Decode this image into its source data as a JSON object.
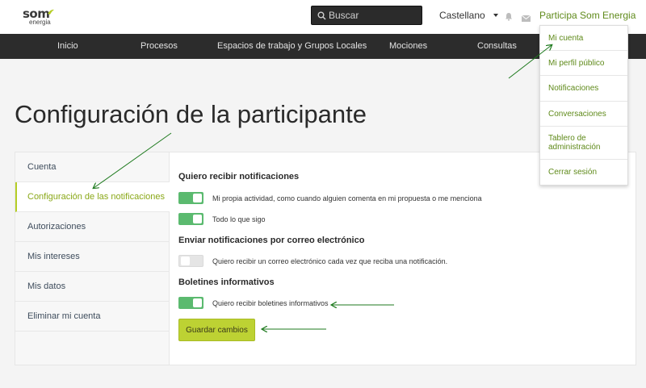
{
  "header": {
    "logo_main": "som",
    "logo_sub": "energia",
    "search_placeholder": "Buscar",
    "language": "Castellano",
    "user_link": "Participa Som Energia"
  },
  "nav": {
    "items": [
      "Inicio",
      "Procesos",
      "Espacios de trabajo y Grupos Locales",
      "Mociones",
      "Consultas"
    ]
  },
  "page": {
    "title": "Configuración de la participante"
  },
  "sidebar": {
    "items": [
      {
        "label": "Cuenta",
        "active": false
      },
      {
        "label": "Configuración de las notificaciones",
        "active": true
      },
      {
        "label": "Autorizaciones",
        "active": false
      },
      {
        "label": "Mis intereses",
        "active": false
      },
      {
        "label": "Mis datos",
        "active": false
      },
      {
        "label": "Eliminar mi cuenta",
        "active": false
      }
    ]
  },
  "content": {
    "section1_title": "Quiero recibir notificaciones",
    "own_activity_label": "Mi propia actividad, como cuando alguien comenta en mi propuesta o me menciona",
    "own_activity_on": true,
    "following_label": "Todo lo que sigo",
    "following_on": true,
    "section2_title": "Enviar notificaciones por correo electrónico",
    "email_label": "Quiero recibir un correo electrónico cada vez que reciba una notificación.",
    "email_on": false,
    "section3_title": "Boletines informativos",
    "newsletter_label": "Quiero recibir boletines informativos",
    "newsletter_on": true,
    "save_label": "Guardar cambios"
  },
  "dropdown": {
    "items": [
      "Mi cuenta",
      "Mi perfil público",
      "Notificaciones",
      "Conversaciones",
      "Tablero de administración",
      "Cerrar sesión"
    ]
  },
  "colors": {
    "accent_green": "#5f8a1a",
    "toggle_on": "#5bba6f",
    "save_button": "#bdd233",
    "annotation_arrow": "#1e7a1e",
    "navbar": "#2c2c2c"
  }
}
